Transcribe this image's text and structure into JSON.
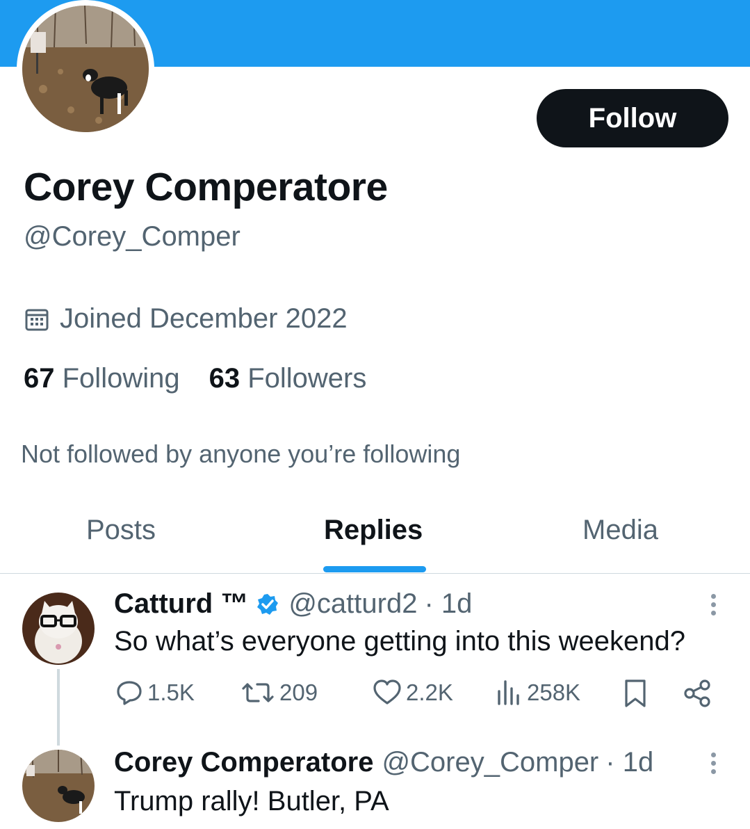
{
  "profile": {
    "display_name": "Corey Comperatore",
    "handle": "@Corey_Comper",
    "joined": "Joined December 2022",
    "following_count": "67",
    "following_label": "Following",
    "followers_count": "63",
    "followers_label": "Followers",
    "not_followed": "Not followed by anyone you’re following",
    "follow_label": "Follow",
    "banner_color": "#1d9bf0"
  },
  "tabs": [
    {
      "label": "Posts",
      "active": false
    },
    {
      "label": "Replies",
      "active": true
    },
    {
      "label": "Media",
      "active": false
    }
  ],
  "tweets": [
    {
      "name": "Catturd ™",
      "verified": true,
      "handle": "@catturd2",
      "time": "· 1d",
      "text": "So what’s everyone getting into this weekend?",
      "replies": "1.5K",
      "reposts": "209",
      "likes": "2.2K",
      "views": "258K"
    },
    {
      "name": "Corey Comperatore",
      "handle": "@Corey_Comper",
      "time": "· 1d",
      "text": "Trump rally! Butler, PA"
    }
  ],
  "icons": [
    "calendar-icon",
    "verified-badge-icon",
    "reply-icon",
    "repost-icon",
    "like-icon",
    "views-icon",
    "bookmark-icon",
    "share-icon",
    "more-icon"
  ],
  "colors": {
    "accent": "#1d9bf0",
    "text": "#0f1419",
    "secondary": "#536471"
  }
}
